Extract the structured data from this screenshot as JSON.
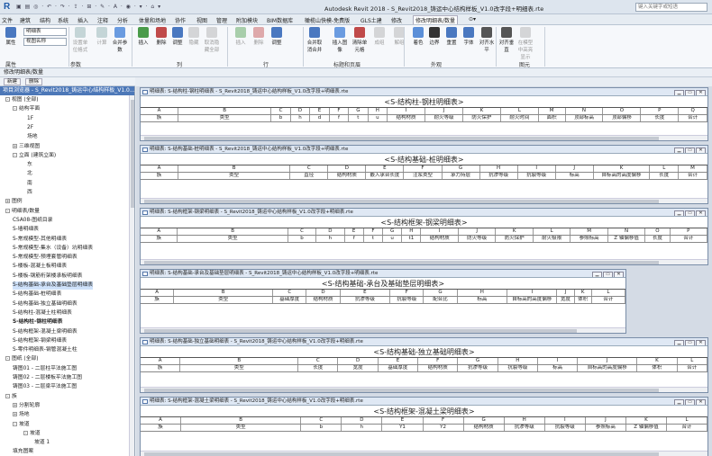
{
  "app": {
    "logo": "R",
    "title": "Autodesk Revit 2018 -    S_Revit2018_铸运中心结构样板_V1.0改字段+明细表.rte",
    "qat": "▣ ▤ ◎ · ↶ · ↷ · ⇪ · ⊞ · ✎ · A · ◉ · ▾ · ⌂ ▾",
    "search_placeholder": "键入关键字或短语"
  },
  "menu": [
    {
      "label": "文件"
    },
    {
      "label": "建筑"
    },
    {
      "label": "结构"
    },
    {
      "label": "系统"
    },
    {
      "label": "插入"
    },
    {
      "label": "注释"
    },
    {
      "label": "分析"
    },
    {
      "label": "体量和场地"
    },
    {
      "label": "协作"
    },
    {
      "label": "视图"
    },
    {
      "label": "管理"
    },
    {
      "label": "附加模块"
    },
    {
      "label": "BIM数据库"
    },
    {
      "label": "橄榄山快模-免费版"
    },
    {
      "label": "GLS土建"
    },
    {
      "label": "修改"
    },
    {
      "label": "修改明细表/数量"
    },
    {
      "label": "⊙▾"
    }
  ],
  "ribbon": {
    "dd1": "明细表",
    "dd2": "视图名称",
    "buttons": [
      {
        "label": "属性"
      },
      {
        "label": "设置单位格式"
      },
      {
        "label": "计算"
      },
      {
        "label": "合并参数"
      },
      {
        "label": "插入"
      },
      {
        "label": "删除"
      },
      {
        "label": "调整"
      },
      {
        "label": "隐藏"
      },
      {
        "label": "取消隐藏全部"
      },
      {
        "label": "插入"
      },
      {
        "label": "删除"
      },
      {
        "label": "调整"
      },
      {
        "label": "合并取消合并"
      },
      {
        "label": "插入图像"
      },
      {
        "label": "清除单元格"
      },
      {
        "label": "成组"
      },
      {
        "label": "解组"
      },
      {
        "label": "着色"
      },
      {
        "label": "边界"
      },
      {
        "label": "重置"
      },
      {
        "label": "字体"
      },
      {
        "label": "对齐水平"
      },
      {
        "label": "对齐垂直"
      },
      {
        "label": "在模型中高亮显示"
      }
    ],
    "groups": [
      "属性",
      "参数",
      "列",
      "行",
      "标题和页眉",
      "外观",
      "图元"
    ]
  },
  "context_label": "修改明细表/数量",
  "toolbar2": {
    "new": "新建",
    "delete": "删除"
  },
  "browser": {
    "title": "项目浏览器 - S_Revit2018_铸运中心结构样板_V1.0...",
    "nodes": [
      "视图 (全部)",
      "结构平面",
      "1F",
      "2F",
      "场地",
      "三维视图",
      "立面 (建筑立面)",
      "东",
      "北",
      "南",
      "西",
      "图例",
      "明细表/数量",
      "CSA08-图纸目录",
      "S-墙明细表",
      "S-常规模型-其他明细表",
      "S-常规模型-集水（设备）坑明细表",
      "S-常规模型-预埋套管明细表",
      "S-楼板-混凝土板明细表",
      "S-楼板-钢筋桁架楼承板明细表",
      "S-结构基础-承台及基础垫层明细表",
      "S-结构基础-桩明细表",
      "S-结构基础-独立基础明细表",
      "S-结构柱-混凝土柱明细表",
      "S-结构柱-钢柱明细表",
      "S-结构框架-混凝土梁明细表",
      "S-结构框架-钢梁明细表",
      "S-零件明细表-钢管混凝土柱",
      "图纸 (全部)",
      "铸图01 - 二层柱平法施工图",
      "铸图02 - 二层楼板平法施工图",
      "铸图03 - 二层梁平法施工图",
      "族",
      "分割轮廓",
      "场地",
      "坡道",
      "坡道",
      "坡道 1",
      "填充图案"
    ]
  },
  "schedules": [
    {
      "tab": "明细表: S-结构柱-钢柱明细表 - S_Revit2018_铸运中心结构样板_V1.0改字段+明细表.rte",
      "title": "<S-结构柱-钢柱明细表>",
      "letters": [
        "A",
        "B",
        "C",
        "D",
        "E",
        "F",
        "G",
        "H",
        "I",
        "J",
        "K",
        "L",
        "M",
        "N",
        "O",
        "P",
        "Q"
      ],
      "headers": [
        "族",
        "类型",
        "b",
        "h",
        "d",
        "f",
        "t",
        "u",
        "结构材质",
        "耐火等级",
        "防火保护",
        "耐火时间",
        "面积",
        "顶部标高",
        "顶部偏移",
        "长度",
        "合计"
      ]
    },
    {
      "tab": "明细表: S-结构基础-桩明细表 - S_Revit2018_铸运中心结构样板_V1.0改字段+明细表.rte",
      "title": "<S-结构基础-桩明细表>",
      "letters": [
        "A",
        "B",
        "C",
        "D",
        "E",
        "F",
        "G",
        "H",
        "I",
        "J",
        "K",
        "L",
        "M"
      ],
      "headers": [
        "族",
        "类型",
        "直径",
        "结构材质",
        "嵌入承台长度",
        "注浆类型",
        "承力持层",
        "抗渗等级",
        "抗裂等级",
        "标高",
        "自标高的高度偏移",
        "长度",
        "合计"
      ]
    },
    {
      "tab": "明细表: S-结构框架-钢梁明细表 - S_Revit2018_铸运中心结构样板_V1.0改字段+明细表.rte",
      "title": "<S-结构框架-钢梁明细表>",
      "letters": [
        "A",
        "B",
        "C",
        "D",
        "E",
        "F",
        "G",
        "H",
        "I",
        "J",
        "K",
        "L",
        "M",
        "N",
        "O",
        "P"
      ],
      "headers": [
        "族",
        "类型",
        "b",
        "h",
        "f",
        "t",
        "u",
        "t1",
        "结构材质",
        "防火等级",
        "防火保护",
        "耐火极限",
        "参照标高",
        "Z 轴偏移值",
        "长度",
        "合计"
      ]
    },
    {
      "tab": "明细表: S-结构基础-承台及基础垫层明细表 - S_Revit2018_铸运中心结构样板_V1.0改字段+明细表.rte",
      "title": "<S-结构基础-承台及基础垫层明细表>",
      "letters": [
        "A",
        "B",
        "C",
        "D",
        "E",
        "F",
        "G",
        "H",
        "I",
        "J",
        "K",
        "L"
      ],
      "headers": [
        "族",
        "类型",
        "基础厚度",
        "结构材质",
        "抗渗等级",
        "抗裂等级",
        "配合比",
        "标高",
        "自标高的高度偏移",
        "宽度",
        "体积",
        "合计"
      ]
    },
    {
      "tab": "明细表: S-结构基础-独立基础明细表 - S_Revit2018_铸运中心结构样板_V1.0改字段+明细表.rte",
      "title": "<S-结构基础-独立基础明细表>",
      "letters": [
        "A",
        "B",
        "C",
        "D",
        "E",
        "F",
        "G",
        "H",
        "I",
        "J",
        "K",
        "L"
      ],
      "headers": [
        "族",
        "类型",
        "长度",
        "宽度",
        "基础厚度",
        "结构材质",
        "抗渗等级",
        "抗裂等级",
        "标高",
        "自标高的高度偏移",
        "体积",
        "合计"
      ]
    },
    {
      "tab": "明细表: S-结构框架-混凝土梁明细表 - S_Revit2018_铸运中心结构样板_V1.0改字段+明细表.rte",
      "title": "<S-结构框架-混凝土梁明细表>",
      "letters": [
        "A",
        "B",
        "C",
        "D",
        "E",
        "F",
        "G",
        "H",
        "I",
        "J",
        "K",
        "L"
      ],
      "headers": [
        "族",
        "类型",
        "b",
        "h",
        "Y1",
        "Y2",
        "结构材质",
        "抗渗等级",
        "抗裂等级",
        "参照标高",
        "Z 轴偏移值",
        "合计"
      ]
    }
  ]
}
